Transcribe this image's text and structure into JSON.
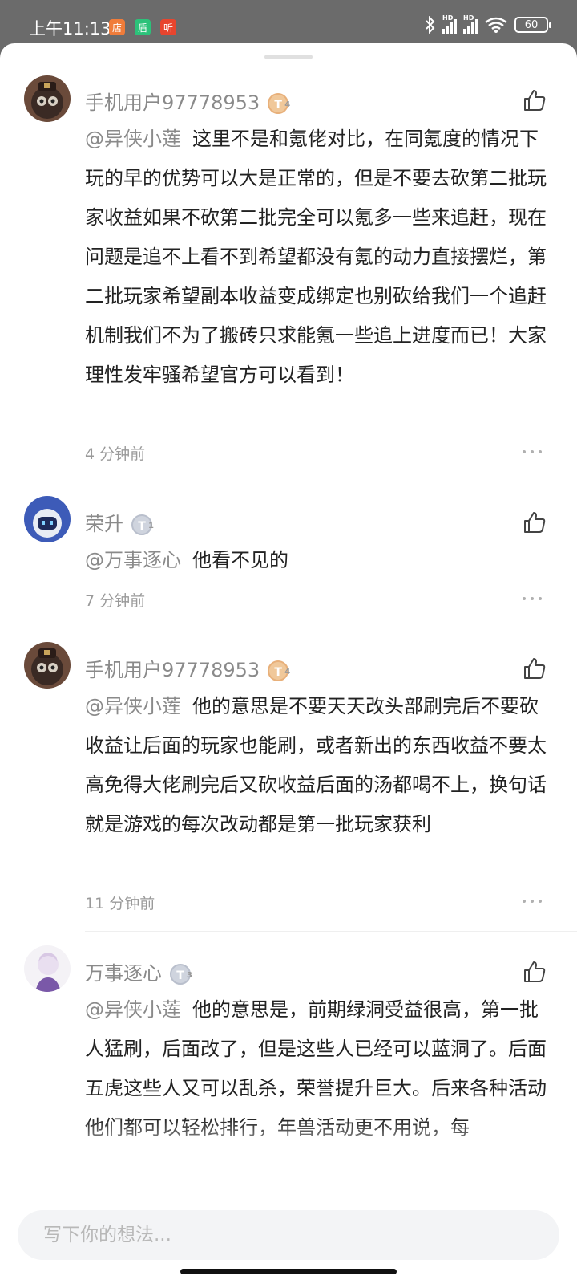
{
  "status_bar": {
    "time": "上午11:13",
    "badges": [
      "店",
      "盾",
      "听"
    ],
    "battery": "60",
    "signal_label": "HD"
  },
  "comments": [
    {
      "username": "手机用户97778953",
      "level": "4",
      "mention": "@异侠小莲",
      "text": "这里不是和氪佬对比，在同氪度的情况下玩的早的优势可以大是正常的，但是不要去砍第二批玩家收益如果不砍第二批完全可以氪多一些来追赶，现在问题是追不上看不到希望都没有氪的动力直接摆烂，第二批玩家希望副本收益变成绑定也别砍给我们一个追赶机制我们不为了搬砖只求能氪一些追上进度而已！大家理性发牢骚希望官方可以看到！",
      "time": "4 分钟前"
    },
    {
      "username": "荣升",
      "level": "1",
      "mention": "@万事逐心",
      "text": "他看不见的",
      "time": "7 分钟前"
    },
    {
      "username": "手机用户97778953",
      "level": "4",
      "mention": "@异侠小莲",
      "text": "他的意思是不要天天改头部刷完后不要砍收益让后面的玩家也能刷，或者新出的东西收益不要太高免得大佬刷完后又砍收益后面的汤都喝不上，换句话就是游戏的每次改动都是第一批玩家获利",
      "time": "11 分钟前"
    },
    {
      "username": "万事逐心",
      "level": "3",
      "mention": "@异侠小莲",
      "text": "他的意思是，前期绿洞受益很高，第一批人猛刷，后面改了，但是这些人已经可以蓝洞了。后面五虎这些人又可以乱杀，荣誉提升巨大。后来各种活动他们都可以轻松排行，年兽活动更不用说，每",
      "time": ""
    }
  ],
  "input": {
    "placeholder": "写下你的想法..."
  },
  "colors": {
    "status_bg": "#6b6b6b",
    "username": "#8a8a8a",
    "text": "#222222",
    "badge_orange": "#f07c3a",
    "badge_green": "#2cc27a",
    "badge_red": "#e8452e"
  }
}
